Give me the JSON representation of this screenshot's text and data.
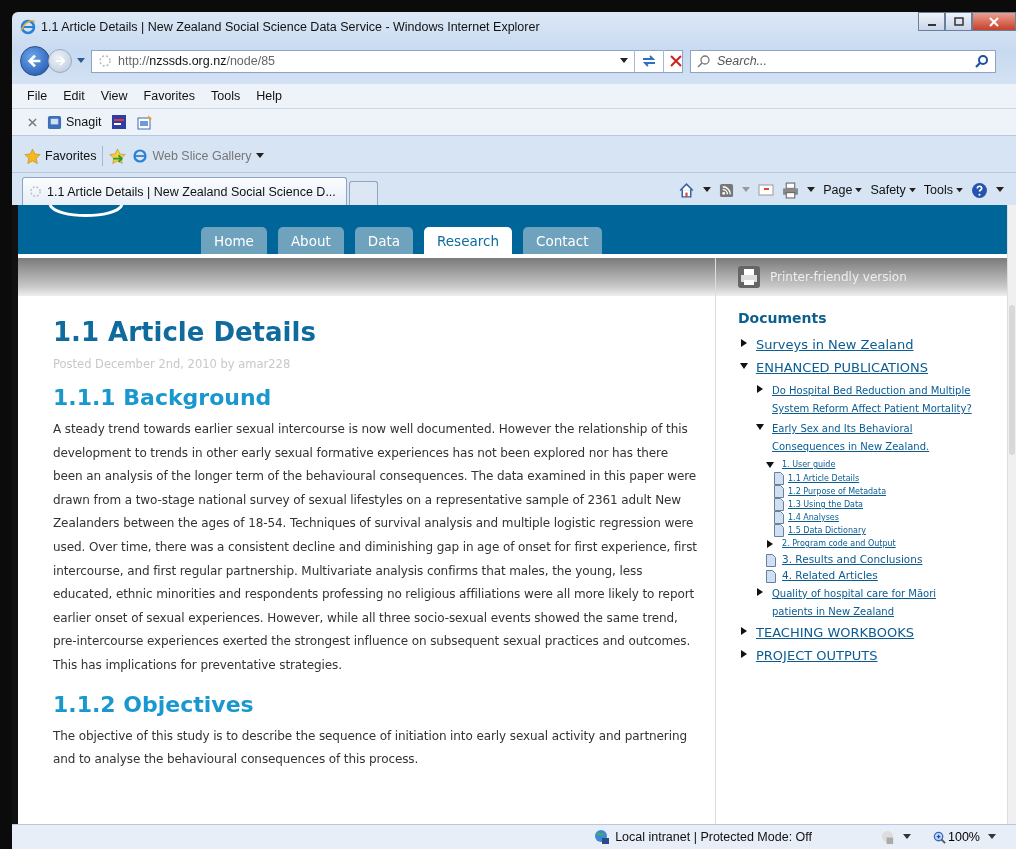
{
  "window": {
    "title": "1.1 Article Details | New Zealand Social Science Data Service - Windows Internet Explorer"
  },
  "address_bar": {
    "url": "http://**nzssds.org.nz**/node/85"
  },
  "search": {
    "placeholder": "Search..."
  },
  "menu": [
    "File",
    "Edit",
    "View",
    "Favorites",
    "Tools",
    "Help"
  ],
  "toolbar": {
    "snagit": "Snagit"
  },
  "favorites_bar": {
    "favorites": "Favorites",
    "web_slice": "Web Slice Gallery"
  },
  "tabs": [
    {
      "label": "1.1 Article Details | New Zealand Social Science D...",
      "selected": true
    }
  ],
  "command_bar": [
    "Page",
    "Safety",
    "Tools"
  ],
  "site_nav": [
    {
      "label": "Home",
      "selected": false
    },
    {
      "label": "About",
      "selected": false
    },
    {
      "label": "Data",
      "selected": false
    },
    {
      "label": "Research",
      "selected": true
    },
    {
      "label": "Contact",
      "selected": false
    }
  ],
  "printer_link": "Printer-friendly version",
  "article": {
    "title": "1.1 Article Details",
    "meta": "Posted December 2nd, 2010 by amar228",
    "sections": [
      {
        "heading": "1.1.1 Background",
        "paragraphs": [
          "A steady trend towards earlier sexual intercourse is now well documented. However the relationship of this development to trends in other early sexual formative experiences has not been explored nor has there been an analysis of the longer term of the behavioural consequences. The data examined in this paper were drawn from a two-stage national survey of sexual lifestyles on a representative sample of 2361 adult New Zealanders between the ages of 18-54. Techniques of survival analysis and multiple logistic regression were used. Over time, there was a consistent decline and diminishing gap in age of onset for first experience, first intercourse, and first regular partnership. Multivariate analysis confirms that males, the young, less educated, ethnic minorities and respondents professing no religious affiliations were all more likely to report earlier onset of sexual experiences. However, while all three socio-sexual events showed the same trend, pre-intercourse experiences exerted the strongest influence on subsequent sexual practices and outcomes. This has implications for preventative strategies."
        ]
      },
      {
        "heading": "1.1.2 Objectives",
        "paragraphs": [
          "The objective of this study is to describe the sequence of initiation into early sexual activity and partnering and to analyse the behavioural consequences of this process."
        ]
      }
    ]
  },
  "sidebar": {
    "title": "Documents",
    "tree": [
      {
        "label": "Surveys in New Zealand",
        "kind": "folder",
        "expanded": false
      },
      {
        "label": "ENHANCED PUBLICATIONS",
        "kind": "folder",
        "expanded": true,
        "children": [
          {
            "label": "Do Hospital Bed Reduction and Multiple System Reform Affect Patient Mortality?",
            "kind": "folder",
            "expanded": false
          },
          {
            "label": "Early Sex and Its Behavioral Consequences in New Zealand.",
            "kind": "folder",
            "expanded": true,
            "children": [
              {
                "label": "1. User guide",
                "kind": "folder",
                "expanded": true,
                "children": [
                  {
                    "label": "1.1 Article Details",
                    "kind": "page"
                  },
                  {
                    "label": "1.2 Purpose of Metadata",
                    "kind": "page"
                  },
                  {
                    "label": "1.3 Using the Data",
                    "kind": "page"
                  },
                  {
                    "label": "1.4 Analyses",
                    "kind": "page"
                  },
                  {
                    "label": "1.5 Data Dictionary",
                    "kind": "page"
                  }
                ]
              },
              {
                "label": "2. Program code and Output",
                "kind": "folder",
                "expanded": false
              },
              {
                "label": "3. Results and Conclusions",
                "kind": "page"
              },
              {
                "label": "4. Related Articles",
                "kind": "page"
              }
            ]
          },
          {
            "label": "Quality of hospital care for Māori patients in New Zealand",
            "kind": "folder",
            "expanded": false
          }
        ]
      },
      {
        "label": "TEACHING WORKBOOKS",
        "kind": "folder",
        "expanded": false
      },
      {
        "label": "PROJECT OUTPUTS",
        "kind": "folder",
        "expanded": false
      }
    ]
  },
  "status_bar": {
    "zone": "Local intranet | Protected Mode: Off",
    "zoom": "100%"
  }
}
